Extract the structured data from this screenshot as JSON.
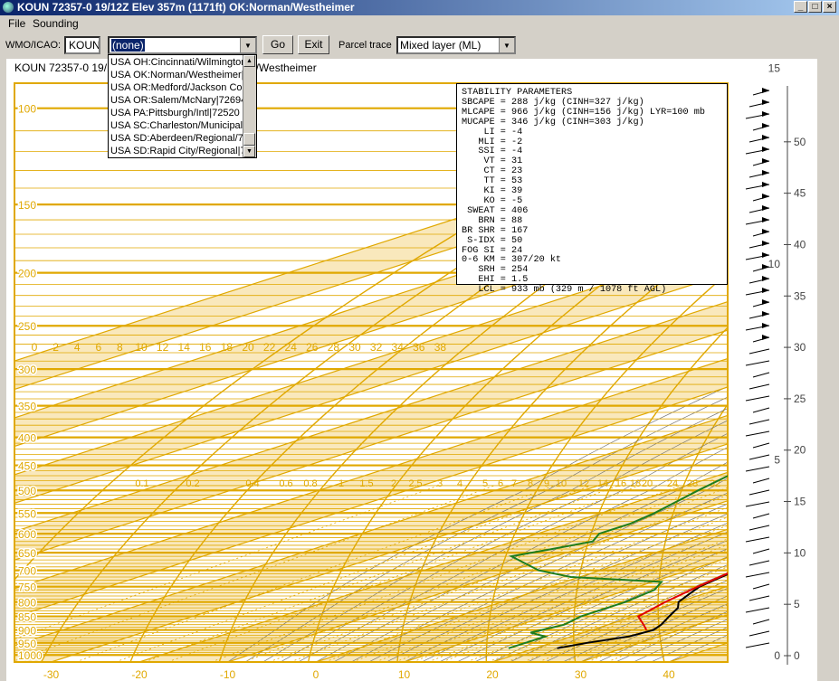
{
  "window": {
    "title": "KOUN 72357-0 19/12Z  Elev 357m (1171ft) OK:Norman/Westheimer"
  },
  "menu": {
    "items": [
      "File",
      "Sounding"
    ]
  },
  "toolbar": {
    "wmo_label": "WMO/ICAO:",
    "wmo_value": "KOUN",
    "station_value": "(none)",
    "go_label": "Go",
    "exit_label": "Exit",
    "parcel_label": "Parcel trace",
    "parcel_value": "Mixed layer (ML)"
  },
  "station_dropdown": {
    "options": [
      "USA OH:Cincinnati/Wilmington/72426",
      "USA OK:Norman/Westheimer|72357",
      "USA OR:Medford/Jackson Co|72597",
      "USA OR:Salem/McNary|72694",
      "USA PA:Pittsburgh/Intl|72520",
      "USA SC:Charleston/Municipal|72208",
      "USA SD:Aberdeen/Regional/72659",
      "USA SD:Rapid City/Regional|72662"
    ]
  },
  "chart_header": {
    "text": "KOUN 72357-0 19/12Z 357m (1171ft) OK:Norman/Westheimer"
  },
  "stability": {
    "title": "STABILITY PARAMETERS",
    "lines": [
      "SBCAPE = 288 j/kg (CINH=327 j/kg)",
      "MLCAPE = 966 j/kg (CINH=156 j/kg) LYR=100 mb",
      "MUCAPE = 346 j/kg (CINH=303 j/kg)",
      "    LI = -4",
      "   MLI = -2",
      "   SSI = -4",
      "    VT = 31",
      "    CT = 23",
      "    TT = 53",
      "    KI = 39",
      "    KO = -5",
      " SWEAT = 406",
      "   BRN = 88",
      "BR SHR = 167",
      " S-IDX = 50",
      "FOG SI = 24",
      "0-6 KM = 307/20 kt",
      "   SRH = 254",
      "   EHI = 1.5",
      "   LCL = 933 mb (329 m / 1078 ft AGL)"
    ]
  },
  "colors": {
    "grid": "#e0a800",
    "temperature": "#000000",
    "dewpoint": "#1e7d1e",
    "parcel": "#e00000",
    "shade": "#f7e0a6"
  },
  "chart_data": {
    "type": "line",
    "pressure_levels_hpa": [
      100,
      150,
      200,
      250,
      300,
      350,
      400,
      450,
      500,
      550,
      600,
      650,
      700,
      750,
      800,
      850,
      900,
      950,
      1000
    ],
    "temperature_axis_c": [
      -30,
      -20,
      -10,
      0,
      10,
      20,
      30,
      40
    ],
    "mixing_ratio_labels": [
      "0.1",
      "0.2",
      "0.4",
      "0.6",
      "0.8",
      "1",
      "1.5",
      "2",
      "2.5",
      "3",
      "4",
      "5",
      "6",
      "7",
      "8",
      "9",
      "10",
      "12",
      "14",
      "16",
      "18",
      "20",
      "24",
      "28",
      "32"
    ],
    "wetbulb_labels": [
      "0",
      "2",
      "4",
      "6",
      "8",
      "10",
      "12",
      "14",
      "16",
      "18",
      "20",
      "22",
      "24",
      "26",
      "28",
      "30",
      "32",
      "34",
      "36",
      "38"
    ],
    "height_km_labels": [
      "0",
      "5",
      "10",
      "15",
      "20",
      "25",
      "30",
      "35",
      "40",
      "45",
      "50"
    ],
    "height_kft_labels": [
      "0",
      "5",
      "10",
      "15"
    ],
    "series": [
      {
        "key": "temperature",
        "points": [
          [
            972,
            22.5
          ],
          [
            950,
            24
          ],
          [
            925,
            26.5
          ],
          [
            900,
            27
          ],
          [
            880,
            26
          ],
          [
            850,
            24
          ],
          [
            820,
            22
          ],
          [
            800,
            20
          ],
          [
            775,
            18.5
          ],
          [
            750,
            17
          ],
          [
            725,
            16.2
          ],
          [
            700,
            15.5
          ],
          [
            680,
            14.6
          ],
          [
            650,
            13.5
          ],
          [
            620,
            12
          ],
          [
            600,
            11
          ],
          [
            575,
            10
          ],
          [
            550,
            9
          ],
          [
            525,
            7.5
          ],
          [
            500,
            5.5
          ],
          [
            475,
            4
          ],
          [
            450,
            2
          ],
          [
            425,
            0
          ],
          [
            400,
            -3.5
          ],
          [
            375,
            -6.5
          ],
          [
            350,
            -10.5
          ],
          [
            325,
            -14
          ],
          [
            300,
            -17.5
          ],
          [
            275,
            -22
          ],
          [
            250,
            -27
          ],
          [
            225,
            -31.5
          ],
          [
            200,
            -37
          ],
          [
            175,
            -45
          ],
          [
            150,
            -52
          ],
          [
            135,
            -55
          ],
          [
            120,
            -55
          ],
          [
            105,
            -54
          ],
          [
            95,
            -55.5
          ]
        ]
      },
      {
        "key": "dewpoint",
        "points": [
          [
            972,
            17
          ],
          [
            950,
            17
          ],
          [
            925,
            17
          ],
          [
            910,
            14
          ],
          [
            880,
            15
          ],
          [
            850,
            14
          ],
          [
            800,
            14
          ],
          [
            760,
            13
          ],
          [
            735,
            11
          ],
          [
            720,
            -1
          ],
          [
            700,
            -7
          ],
          [
            660,
            -15
          ],
          [
            640,
            -13
          ],
          [
            620,
            -11
          ],
          [
            600,
            -13
          ],
          [
            575,
            -13
          ],
          [
            550,
            -14
          ],
          [
            500,
            -17
          ],
          [
            450,
            -20
          ],
          [
            400,
            -26
          ],
          [
            350,
            -34
          ],
          [
            300,
            -43
          ],
          [
            275,
            -40
          ],
          [
            250,
            -43
          ],
          [
            225,
            -46
          ],
          [
            200,
            -53
          ],
          [
            175,
            -58
          ],
          [
            150,
            -67
          ],
          [
            125,
            -74
          ],
          [
            100,
            -79
          ],
          [
            90,
            -78
          ]
        ]
      },
      {
        "key": "parcel",
        "points": [
          [
            900,
            26.2
          ],
          [
            880,
            24
          ],
          [
            850,
            20.5
          ],
          [
            800,
            18.5
          ],
          [
            750,
            16.8
          ],
          [
            700,
            15.2
          ],
          [
            650,
            13.8
          ],
          [
            600,
            12
          ],
          [
            550,
            9.5
          ],
          [
            500,
            6.5
          ],
          [
            450,
            2.8
          ],
          [
            400,
            -1.7
          ],
          [
            350,
            -7.2
          ],
          [
            300,
            -14.3
          ],
          [
            250,
            -23.5
          ],
          [
            200,
            -34.5
          ],
          [
            150,
            -50
          ]
        ]
      }
    ]
  }
}
